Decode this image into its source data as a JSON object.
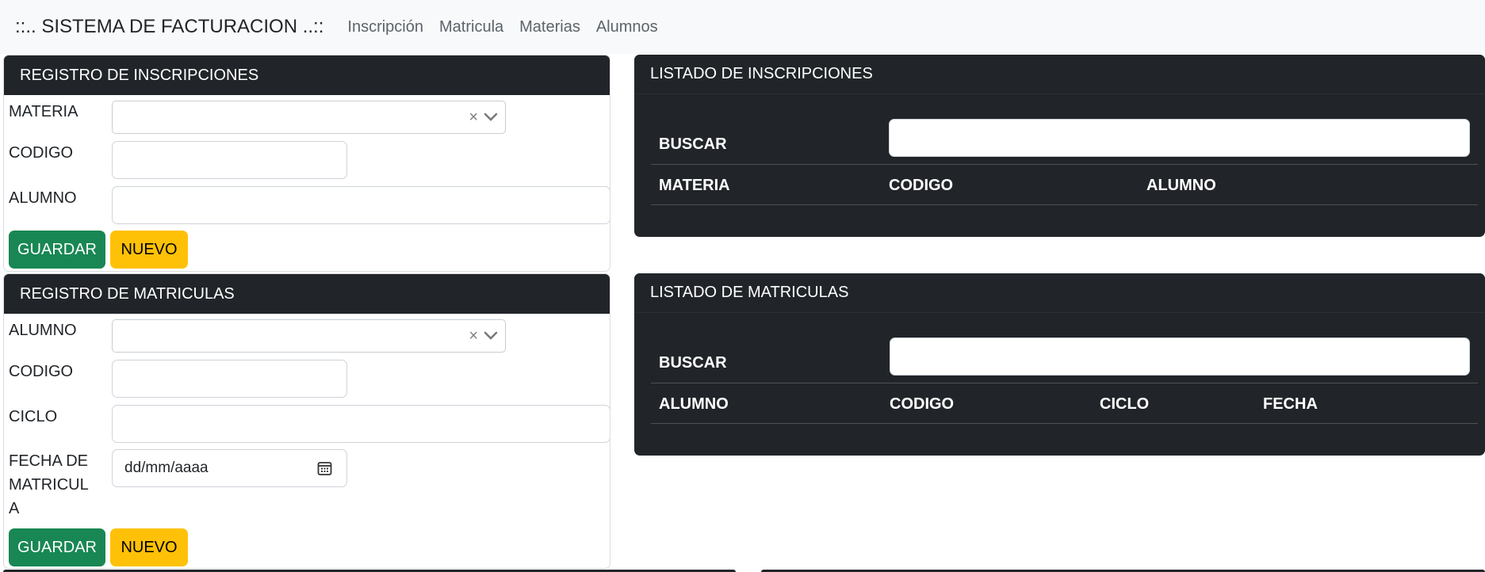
{
  "navbar": {
    "brand": "::.. SISTEMA DE FACTURACION ..::",
    "links": [
      "Inscripción",
      "Matricula",
      "Materias",
      "Alumnos"
    ]
  },
  "inscripciones_form": {
    "title": "REGISTRO DE INSCRIPCIONES",
    "materia_label": "MATERIA",
    "codigo_label": "CODIGO",
    "alumno_label": "ALUMNO",
    "clear_glyph": "×",
    "guardar": "GUARDAR",
    "nuevo": "NUEVO"
  },
  "inscripciones_list": {
    "title": "LISTADO DE INSCRIPCIONES",
    "buscar_label": "BUSCAR",
    "columns": [
      "MATERIA",
      "CODIGO",
      "ALUMNO"
    ]
  },
  "matriculas_form": {
    "title": "REGISTRO DE MATRICULAS",
    "alumno_label": "ALUMNO",
    "codigo_label": "CODIGO",
    "ciclo_label": "CICLO",
    "fecha_label_lines": [
      "FECHA DE",
      "MATRICUL",
      "A"
    ],
    "fecha_placeholder": "dd/mm/aaaa",
    "clear_glyph": "×",
    "guardar": "GUARDAR",
    "nuevo": "NUEVO"
  },
  "matriculas_list": {
    "title": "LISTADO DE MATRICULAS",
    "buscar_label": "BUSCAR",
    "columns": [
      "ALUMNO",
      "CODIGO",
      "CICLO",
      "FECHA"
    ]
  },
  "colors": {
    "dark": "#212529",
    "success": "#198754",
    "warning": "#ffc107",
    "navbar_bg": "#f8f9fa"
  },
  "icons": [
    "clear-icon",
    "chevron-down-icon",
    "calendar-icon"
  ]
}
